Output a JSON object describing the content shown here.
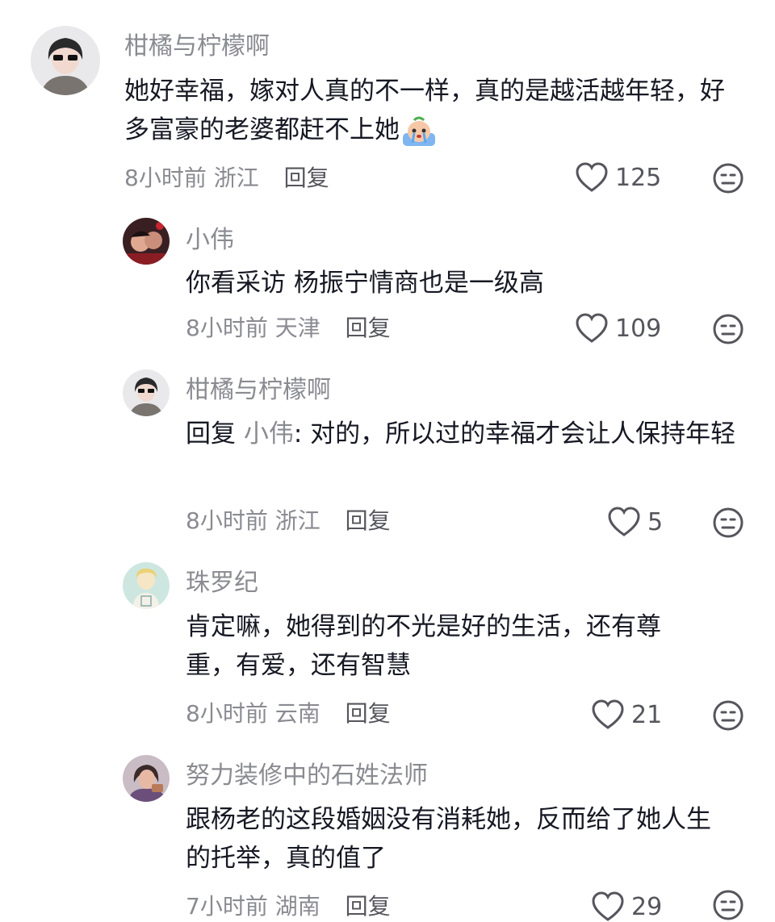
{
  "comments": [
    {
      "username": "柑橘与柠檬啊",
      "text": "她好幸福，嫁对人真的不一样，真的是越活越年轻，好多富豪的老婆都赶不上她",
      "emoji": "crying-emoji",
      "time": "8小时前",
      "location": "浙江",
      "reply_label": "回复",
      "likes": "125"
    },
    {
      "username": "小伟",
      "text": "你看采访 杨振宁情商也是一级高",
      "time": "8小时前",
      "location": "天津",
      "reply_label": "回复",
      "likes": "109"
    },
    {
      "username": "柑橘与柠檬啊",
      "reply_prefix": "回复",
      "mention": "小伟",
      "text": ": 对的，所以过的幸福才会让人保持年轻",
      "time": "8小时前",
      "location": "浙江",
      "reply_label": "回复",
      "likes": "5"
    },
    {
      "username": "珠罗纪",
      "text": "肯定嘛，她得到的不光是好的生活，还有尊重，有爱，还有智慧",
      "time": "8小时前",
      "location": "云南",
      "reply_label": "回复",
      "likes": "21"
    },
    {
      "username": "努力装修中的石姓法师",
      "text": "跟杨老的这段婚姻没有消耗她，反而给了她人生的托举，真的值了",
      "time": "7小时前",
      "location": "湖南",
      "reply_label": "回复",
      "likes": "29"
    }
  ]
}
